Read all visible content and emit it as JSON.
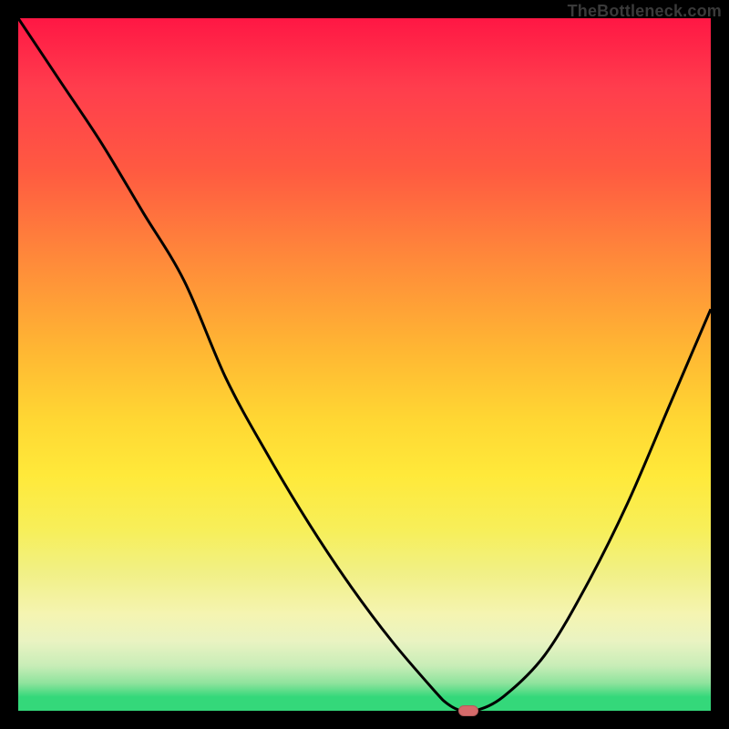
{
  "watermark": "TheBottleneck.com",
  "colors": {
    "frame": "#000000",
    "curve": "#000000",
    "marker": "#d56a6a",
    "gradient_top": "#ff1744",
    "gradient_mid": "#ffd733",
    "gradient_bottom": "#34d87a"
  },
  "chart_data": {
    "type": "line",
    "title": "",
    "subtitle": "",
    "xlabel": "",
    "ylabel": "",
    "xlim": [
      0,
      100
    ],
    "ylim": [
      0,
      100
    ],
    "grid": false,
    "legend": false,
    "annotations": [],
    "series": [
      {
        "name": "bottleneck-curve",
        "x": [
          0,
          6,
          12,
          18,
          24,
          30,
          36,
          42,
          48,
          54,
          60,
          62,
          64,
          66,
          70,
          76,
          82,
          88,
          94,
          100
        ],
        "values": [
          100,
          91,
          82,
          72,
          62,
          48,
          37,
          27,
          18,
          10,
          3,
          1,
          0,
          0,
          2,
          8,
          18,
          30,
          44,
          58
        ]
      }
    ],
    "marker": {
      "name": "optimal-point",
      "x": 65,
      "y": 0
    }
  }
}
